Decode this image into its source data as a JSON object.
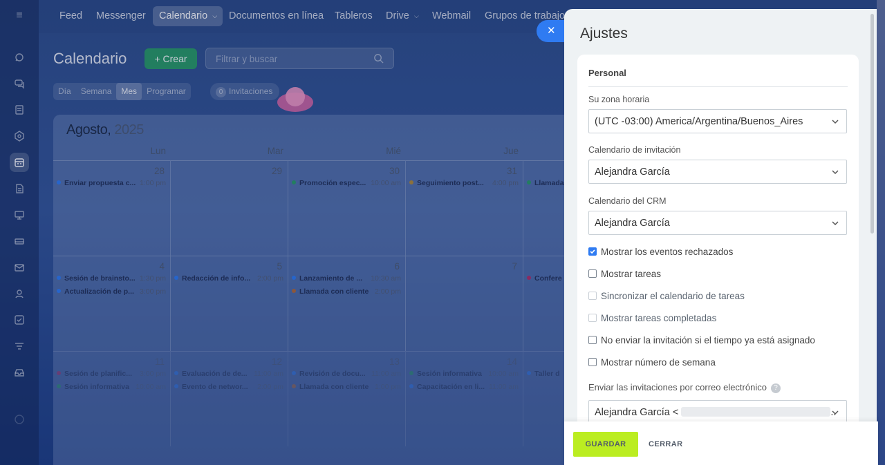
{
  "nav": {
    "items": [
      "Feed",
      "Messenger",
      "Calendario",
      "Documentos en línea",
      "Tableros",
      "Drive",
      "Webmail",
      "Grupos de trabajo"
    ]
  },
  "toolbar": {
    "title": "Calendario",
    "create_label": "Crear",
    "search_placeholder": "Filtrar y buscar",
    "views": [
      "Día",
      "Semana",
      "Mes",
      "Programar"
    ],
    "active_view": "Mes",
    "invites_count": "0",
    "invites_label": "Invitaciones"
  },
  "calendar": {
    "month": "Agosto,",
    "year": "2025",
    "days_of_week": [
      "Lun",
      "Mar",
      "Mié",
      "Jue"
    ],
    "weeks": [
      {
        "days": [
          {
            "num": "28",
            "events": [
              {
                "name": "Enviar propuesta c...",
                "time": "1:00 pm",
                "color": "#2f7bf2"
              }
            ]
          },
          {
            "num": "29",
            "events": []
          },
          {
            "num": "30",
            "events": [
              {
                "name": "Promoción espec...",
                "time": "10:00 am",
                "color": "#2a9b67"
              }
            ]
          },
          {
            "num": "31",
            "events": [
              {
                "name": "Seguimiento post...",
                "time": "4:00 pm",
                "color": "#b08a3a"
              }
            ]
          },
          {
            "num": "",
            "events": [
              {
                "name": "Llamada",
                "time": "",
                "color": "#2a9b67"
              }
            ]
          }
        ]
      },
      {
        "days": [
          {
            "num": "4",
            "events": [
              {
                "name": "Sesión de brainsto...",
                "time": "1:30 pm",
                "color": "#2f7bf2"
              },
              {
                "name": "Actualización de p...",
                "time": "3:00 pm",
                "color": "#2f7bf2"
              }
            ]
          },
          {
            "num": "5",
            "events": [
              {
                "name": "Redacción de info...",
                "time": "2:00 pm",
                "color": "#2f7bf2"
              }
            ]
          },
          {
            "num": "6",
            "events": [
              {
                "name": "Lanzamiento de ...",
                "time": "10:30 am",
                "color": "#2f7bf2"
              },
              {
                "name": "Llamada con cliente",
                "time": "2:00 pm",
                "color": "#b06a3a"
              }
            ]
          },
          {
            "num": "7",
            "events": []
          },
          {
            "num": "",
            "events": [
              {
                "name": "Confere",
                "time": "",
                "color": "#b0306a"
              }
            ]
          }
        ]
      },
      {
        "days": [
          {
            "num": "11",
            "events": [
              {
                "name": "Sesión de planific...",
                "time": "3:00 pm",
                "color": "#b0306a"
              },
              {
                "name": "Sesión informativa",
                "time": "10:00 am",
                "color": "#2a9b67"
              }
            ]
          },
          {
            "num": "12",
            "events": [
              {
                "name": "Evaluación de de...",
                "time": "11:00 am",
                "color": "#2f7bf2"
              },
              {
                "name": "Evento de networ...",
                "time": "2:00 pm",
                "color": "#2f7bf2"
              }
            ]
          },
          {
            "num": "13",
            "events": [
              {
                "name": "Revisión de docu...",
                "time": "11:00 am",
                "color": "#2f7bf2"
              },
              {
                "name": "Llamada con cliente",
                "time": "1:00 pm",
                "color": "#b06a3a"
              }
            ]
          },
          {
            "num": "14",
            "events": [
              {
                "name": "Sesión informativa",
                "time": "10:00 am",
                "color": "#2a9b67"
              },
              {
                "name": "Capacitación en li...",
                "time": "11:00 am",
                "color": "#2f7bf2"
              }
            ]
          },
          {
            "num": "",
            "events": [
              {
                "name": "Taller d",
                "time": "",
                "color": "#2f7bf2"
              }
            ]
          }
        ]
      }
    ]
  },
  "settings": {
    "title": "Ajustes",
    "section": "Personal",
    "timezone_label": "Su zona horaria",
    "timezone_value": "(UTC -03:00) America/Argentina/Buenos_Aires",
    "invite_calendar_label": "Calendario de invitación",
    "invite_calendar_value": "Alejandra García",
    "crm_calendar_label": "Calendario del CRM",
    "crm_calendar_value": "Alejandra García",
    "checkboxes": [
      {
        "label": "Mostrar los eventos rechazados",
        "checked": true,
        "disabled": false
      },
      {
        "label": "Mostrar tareas",
        "checked": false,
        "disabled": false
      },
      {
        "label": "Sincronizar el calendario de tareas",
        "checked": false,
        "disabled": true
      },
      {
        "label": "Mostrar tareas completadas",
        "checked": false,
        "disabled": true
      },
      {
        "label": "No enviar la invitación si el tiempo ya está asignado",
        "checked": false,
        "disabled": false
      },
      {
        "label": "Mostrar número de semana",
        "checked": false,
        "disabled": false
      }
    ],
    "email_label": "Enviar las invitaciones por correo electrónico",
    "email_value": "Alejandra García <",
    "email_suffix": "..",
    "save_label": "GUARDAR",
    "close_label": "CERRAR"
  },
  "colors": {
    "accent": "#2f7bf2",
    "save": "#bbed21",
    "create": "#2a9b67"
  }
}
